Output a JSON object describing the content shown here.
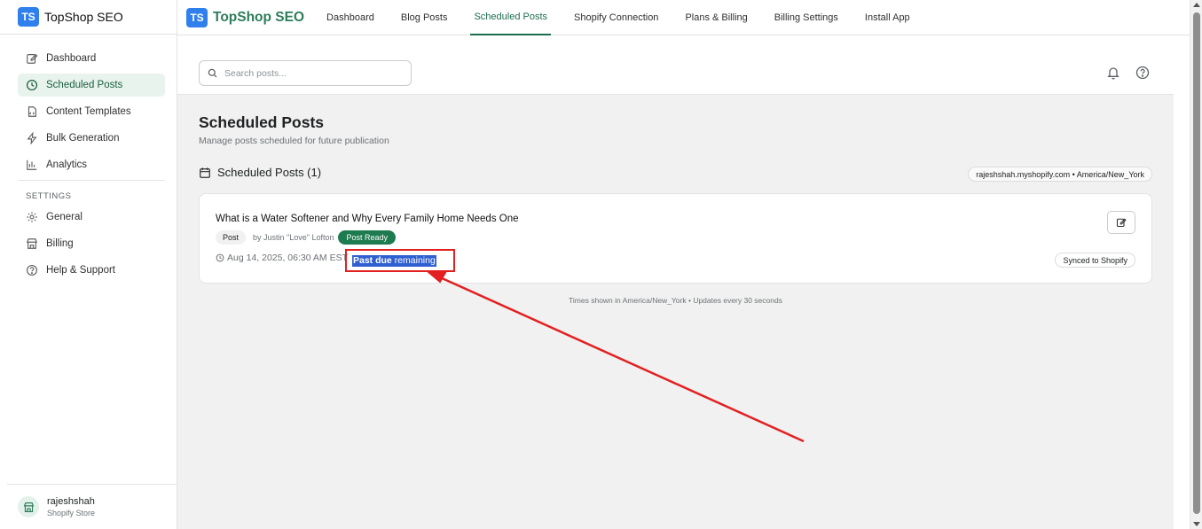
{
  "sidebar": {
    "logo_text": "TS",
    "brand": "TopShop SEO",
    "items": [
      {
        "label": "Dashboard",
        "icon": "edit-icon"
      },
      {
        "label": "Scheduled Posts",
        "icon": "clock-icon"
      },
      {
        "label": "Content Templates",
        "icon": "template-icon"
      },
      {
        "label": "Bulk Generation",
        "icon": "lightning-icon"
      },
      {
        "label": "Analytics",
        "icon": "bar-chart-icon"
      }
    ],
    "settings_label": "SETTINGS",
    "settings_items": [
      {
        "label": "General",
        "icon": "gear-icon"
      },
      {
        "label": "Billing",
        "icon": "store-icon"
      },
      {
        "label": "Help & Support",
        "icon": "help-icon"
      }
    ],
    "store_name": "rajeshshah",
    "store_sub": "Shopify Store"
  },
  "topbar": {
    "logo_text": "TS",
    "brand": "TopShop SEO",
    "tabs": [
      "Dashboard",
      "Blog Posts",
      "Scheduled Posts",
      "Shopify Connection",
      "Plans & Billing",
      "Billing Settings",
      "Install App"
    ],
    "active_tab": "Scheduled Posts"
  },
  "search": {
    "placeholder": "Search posts..."
  },
  "page": {
    "title": "Scheduled Posts",
    "subtitle": "Manage posts scheduled for future publication",
    "section_title": "Scheduled Posts (1)",
    "store_badge": "rajeshshah.myshopify.com • America/New_York",
    "footnote": "Times shown in America/New_York • Updates every 30 seconds"
  },
  "post": {
    "title": "What is a Water Softener and Why Every Family Home Needs One",
    "type": "Post",
    "author": "by Justin \"Love\" Lofton",
    "status": "Post Ready",
    "scheduled_time": "Aug 14, 2025, 06:30 AM EST",
    "remaining_bold": "Past due",
    "remaining_rest": " remaining",
    "sync_status": "Synced to Shopify"
  },
  "colors": {
    "accent": "#1e7a4f",
    "logo": "#2f80ed",
    "annotation": "#e32020",
    "selection": "#2f5fd0"
  }
}
